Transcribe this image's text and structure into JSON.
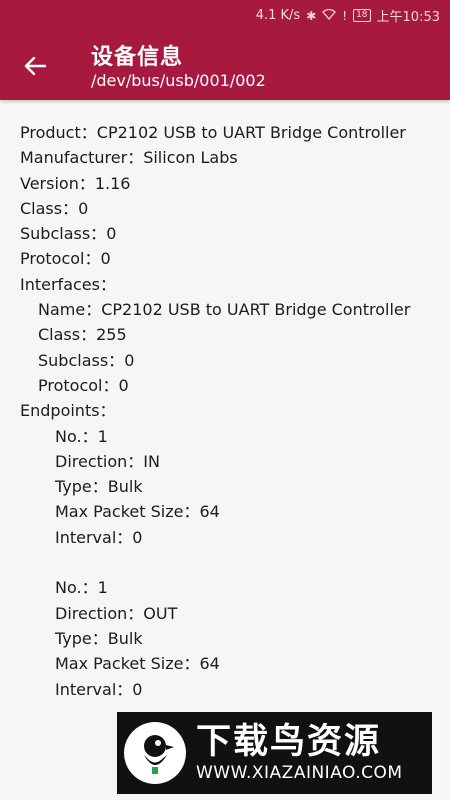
{
  "status_bar": {
    "speed": "4.1 K/s",
    "battery": "18",
    "time": "上午10:53",
    "icons": [
      "bluetooth-icon",
      "wifi-icon",
      "alert-icon",
      "battery-icon"
    ]
  },
  "app_bar": {
    "title": "设备信息",
    "subtitle": "/dev/bus/usb/001/002",
    "back_icon": "arrow-left-icon"
  },
  "device": {
    "product": {
      "label": "Product",
      "value": "CP2102 USB to UART Bridge Controller"
    },
    "manufacturer": {
      "label": "Manufacturer",
      "value": "Silicon Labs"
    },
    "version": {
      "label": "Version",
      "value": "1.16"
    },
    "class": {
      "label": "Class",
      "value": "0"
    },
    "subclass": {
      "label": "Subclass",
      "value": "0"
    },
    "protocol": {
      "label": "Protocol",
      "value": "0"
    },
    "interfaces_label": "Interfaces：",
    "interface": {
      "name": {
        "label": "Name",
        "value": "CP2102 USB to UART Bridge Controller"
      },
      "class": {
        "label": "Class",
        "value": "255"
      },
      "subclass": {
        "label": "Subclass",
        "value": "0"
      },
      "protocol": {
        "label": "Protocol",
        "value": "0"
      }
    },
    "endpoints_label": "Endpoints：",
    "endpoints": [
      {
        "no": {
          "label": "No.",
          "value": "1"
        },
        "direction": {
          "label": "Direction",
          "value": "IN"
        },
        "type": {
          "label": "Type",
          "value": "Bulk"
        },
        "max_packet": {
          "label": "Max Packet Size",
          "value": "64"
        },
        "interval": {
          "label": "Interval",
          "value": "0"
        }
      },
      {
        "no": {
          "label": "No.",
          "value": "1"
        },
        "direction": {
          "label": "Direction",
          "value": "OUT"
        },
        "type": {
          "label": "Type",
          "value": "Bulk"
        },
        "max_packet": {
          "label": "Max Packet Size",
          "value": "64"
        },
        "interval": {
          "label": "Interval",
          "value": "0"
        }
      }
    ]
  },
  "watermark": {
    "title": "下载鸟资源",
    "url": "WWW.XIAZAINIAO.COM"
  },
  "colors": {
    "primary": "#a8193f",
    "background": "#f6f6f6",
    "text": "#1c1c1c"
  }
}
